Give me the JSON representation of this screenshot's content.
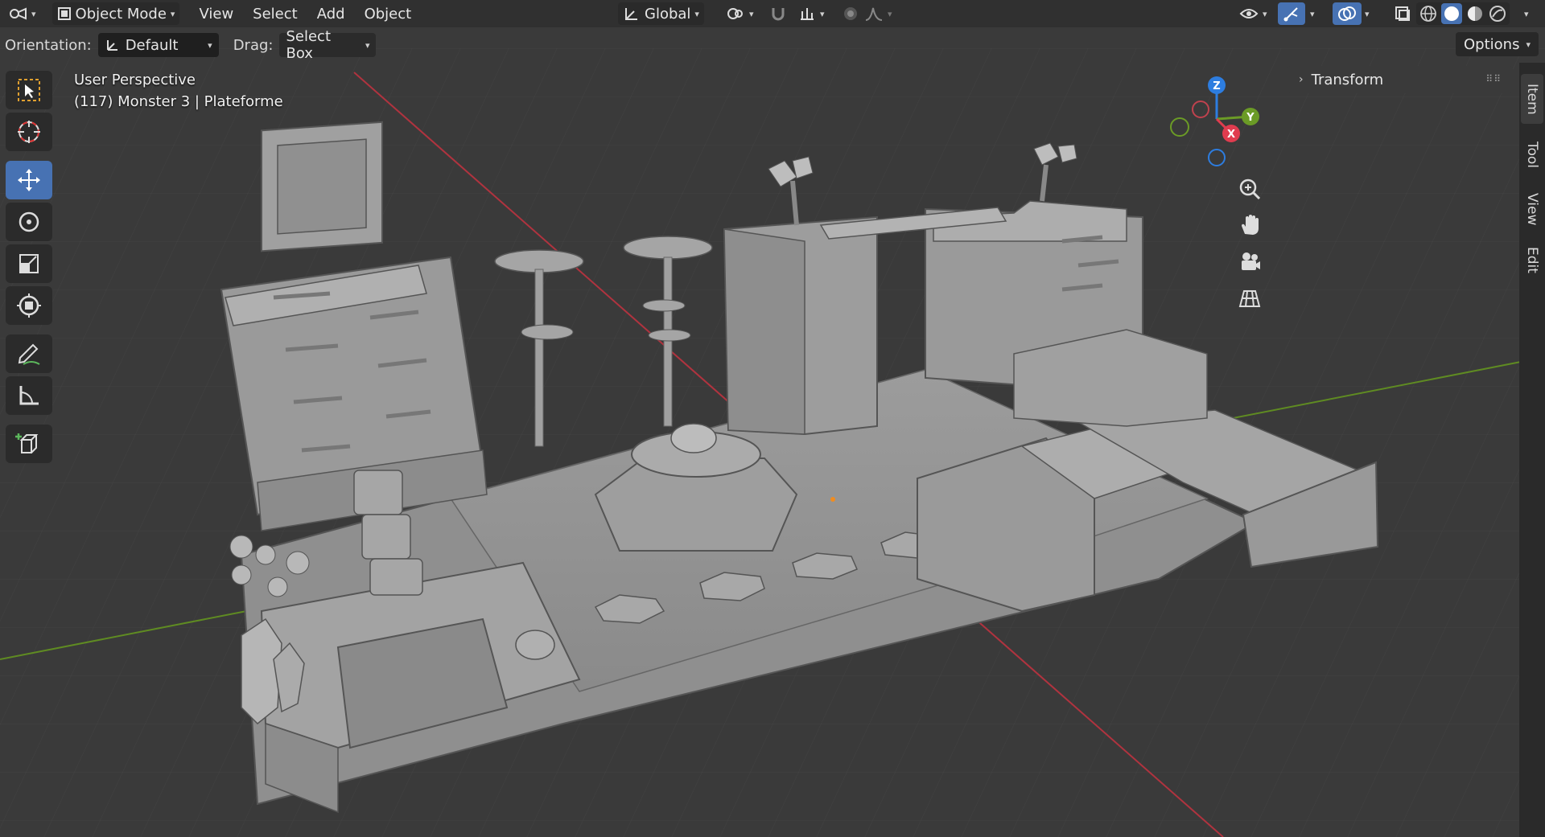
{
  "header": {
    "editor_type_icon": "viewport-icon",
    "mode_label": "Object Mode",
    "menus": [
      "View",
      "Select",
      "Add",
      "Object"
    ],
    "transform_orientation": "Global"
  },
  "tool_settings": {
    "orientation_label": "Orientation:",
    "orientation_value": "Default",
    "drag_label": "Drag:",
    "drag_value": "Select Box",
    "options_label": "Options"
  },
  "viewport": {
    "view_name": "User Perspective",
    "object_info": "(117) Monster 3 | Plateforme"
  },
  "gizmo": {
    "x": "X",
    "y": "Y",
    "z": "Z"
  },
  "sidebar": {
    "panel_title": "Transform",
    "tabs": [
      "Item",
      "Tool",
      "View",
      "Edit"
    ]
  },
  "toolbar": {
    "tools": [
      "select-box",
      "cursor",
      "move",
      "rotate",
      "scale",
      "transform",
      "annotate",
      "measure",
      "add-cube"
    ],
    "active_tool": "move"
  },
  "colors": {
    "header_bg": "#303030",
    "viewport_bg": "#3a3a3a",
    "accent": "#4772b3",
    "axis_x": "#e03c4f",
    "axis_y": "#6b9b26",
    "axis_z": "#2d7de0"
  }
}
